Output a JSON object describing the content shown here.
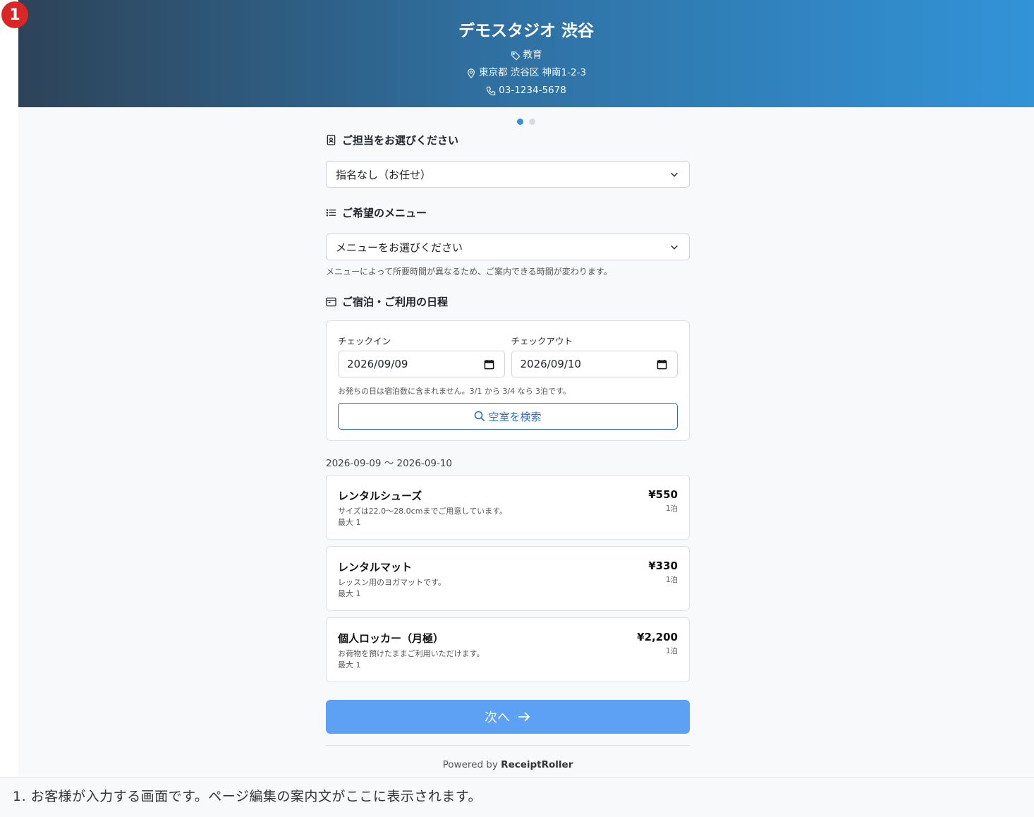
{
  "annotation": {
    "number": "1",
    "text": "1. お客様が入力する画面です。ページ編集の案内文がここに表示されます。"
  },
  "header": {
    "title": "デモスタジオ 渋谷",
    "category": "教育",
    "address": "東京都 渋谷区 神南1-2-3",
    "phone": "03-1234-5678"
  },
  "steps": {
    "total": 2,
    "current": 1
  },
  "staff": {
    "label": "ご担当をお選びください",
    "selected": "指名なし（お任せ）"
  },
  "menu": {
    "label": "ご希望のメニュー",
    "selected": "メニューをお選びください",
    "help": "メニューによって所要時間が異なるため、ご案内できる時間が変わります。"
  },
  "schedule": {
    "label": "ご宿泊・ご利用の日程",
    "checkin_label": "チェックイン",
    "checkin_value": "2026/09/09",
    "checkout_label": "チェックアウト",
    "checkout_value": "2026/09/10",
    "note": "お発ちの日は宿泊数に含まれません。3/1 から 3/4 なら 3泊です。",
    "search_label": "空室を検索"
  },
  "results": {
    "range": "2026-09-09 〜 2026-09-10",
    "items": [
      {
        "name": "レンタルシューズ",
        "desc": "サイズは22.0〜28.0cmまでご用意しています。",
        "max": "最大 1",
        "price": "¥550",
        "unit": "1泊"
      },
      {
        "name": "レンタルマット",
        "desc": "レッスン用のヨガマットです。",
        "max": "最大 1",
        "price": "¥330",
        "unit": "1泊"
      },
      {
        "name": "個人ロッカー（月極）",
        "desc": "お荷物を預けたままご利用いただけます。",
        "max": "最大 1",
        "price": "¥2,200",
        "unit": "1泊"
      }
    ]
  },
  "next_label": "次へ",
  "footer": {
    "powered_prefix": "Powered by",
    "brand": "ReceiptRoller"
  },
  "colors": {
    "accent": "#3293d8",
    "next_button": "#5da1f5",
    "search_outline": "#2d6cc0",
    "badge": "#dc2626"
  },
  "icons": {
    "category": "tag-icon",
    "address": "map-pin-icon",
    "phone": "phone-icon",
    "staff": "person-badge-icon",
    "menu": "list-icon",
    "schedule": "calendar-icon",
    "date": "calendar-input-icon",
    "search": "search-icon",
    "next": "arrow-right-icon",
    "select": "chevron-down-icon"
  }
}
